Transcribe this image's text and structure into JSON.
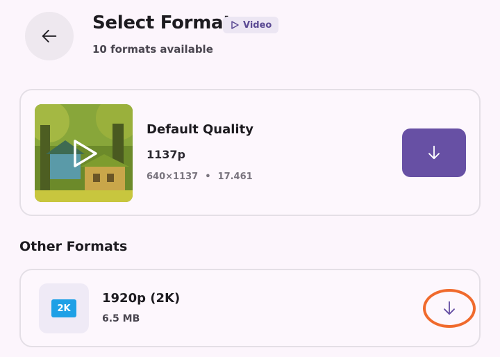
{
  "header": {
    "title": "Select Format",
    "type_chip": "Video",
    "subtitle": "10 formats available"
  },
  "default_format": {
    "title": "Default Quality",
    "resolution": "1137p",
    "dimensions": "640×1137",
    "separator": "•",
    "value": "17.461"
  },
  "other_formats": {
    "section_title": "Other Formats",
    "items": [
      {
        "badge": "2K",
        "name": "1920p (2K)",
        "size": "6.5 MB"
      }
    ]
  },
  "colors": {
    "primary": "#6750a4",
    "highlight_ring": "#f06a2d",
    "badge_2k": "#1ea0e6"
  }
}
